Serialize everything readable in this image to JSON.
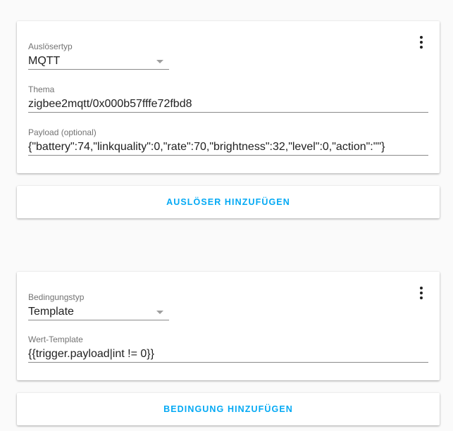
{
  "trigger_card": {
    "type_label": "Auslösertyp",
    "type_value": "MQTT",
    "topic_label": "Thema",
    "topic_value": "zigbee2mqtt/0x000b57fffe72fbd8",
    "payload_label": "Payload (optional)",
    "payload_value": "{\"battery\":74,\"linkquality\":0,\"rate\":70,\"brightness\":32,\"level\":0,\"action\":\"\"}"
  },
  "add_trigger_label": "Auslöser hinzufügen",
  "condition_card": {
    "type_label": "Bedingungstyp",
    "type_value": "Template",
    "template_label": "Wert-Template",
    "template_value": "{{trigger.payload|int != 0}}"
  },
  "add_condition_label": "Bedingung hinzufügen",
  "colors": {
    "accent": "#03a9f4",
    "background": "#fafafa",
    "card": "#ffffff"
  },
  "icons": {
    "menu": "dots-vertical-icon",
    "dropdown": "caret-down-icon"
  }
}
